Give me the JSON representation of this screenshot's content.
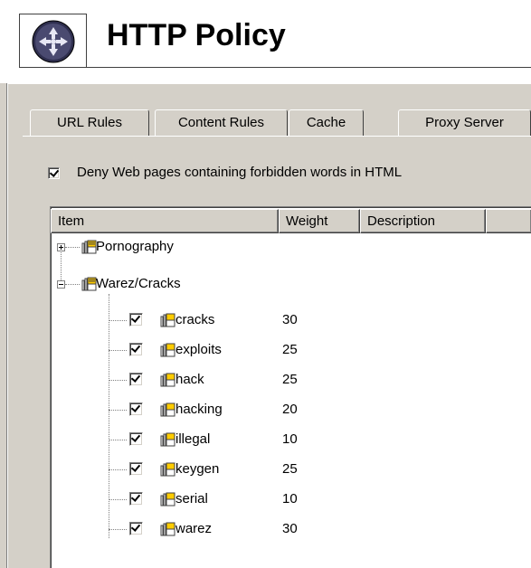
{
  "header": {
    "title": "HTTP Policy",
    "logo_icon": "network-globe-icon"
  },
  "tabs": [
    {
      "label": "URL Rules",
      "active": false
    },
    {
      "label": "Content Rules",
      "active": true
    },
    {
      "label": "Cache",
      "active": false
    },
    {
      "label": "Proxy Server",
      "active": false
    }
  ],
  "content_rules": {
    "deny_checkbox": {
      "checked": true,
      "label": "Deny Web pages containing forbidden words in HTML"
    },
    "list": {
      "columns": [
        "Item",
        "Weight",
        "Description",
        ""
      ],
      "groups": [
        {
          "name": "Pornography",
          "expanded": false,
          "icon": "word-group-icon"
        },
        {
          "name": "Warez/Cracks",
          "expanded": true,
          "icon": "word-group-icon",
          "items": [
            {
              "word": "cracks",
              "weight": "30",
              "checked": true
            },
            {
              "word": "exploits",
              "weight": "25",
              "checked": true
            },
            {
              "word": "hack",
              "weight": "25",
              "checked": true
            },
            {
              "word": "hacking",
              "weight": "20",
              "checked": true
            },
            {
              "word": "illegal",
              "weight": "10",
              "checked": true
            },
            {
              "word": "keygen",
              "weight": "25",
              "checked": true
            },
            {
              "word": "serial",
              "weight": "10",
              "checked": true
            },
            {
              "word": "warez",
              "weight": "30",
              "checked": true
            }
          ]
        }
      ]
    }
  },
  "colors": {
    "dialog_bg": "#d4d0c8",
    "list_bg": "#ffffff",
    "icon_dark": "#3a3a5a"
  }
}
